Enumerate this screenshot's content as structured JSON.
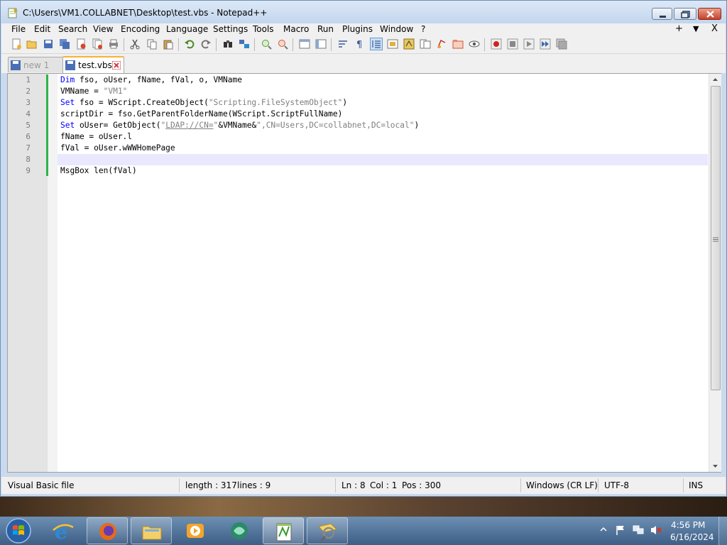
{
  "window": {
    "title": "C:\\Users\\VM1.COLLABNET\\Desktop\\test.vbs - Notepad++"
  },
  "menu": {
    "items": [
      "File",
      "Edit",
      "Search",
      "View",
      "Encoding",
      "Language",
      "Settings",
      "Tools",
      "Macro",
      "Run",
      "Plugins",
      "Window",
      "?"
    ],
    "right_controls": [
      "+",
      "▼",
      "X"
    ]
  },
  "tabs": [
    {
      "label": "new 1",
      "active": false
    },
    {
      "label": "test.vbs",
      "active": true
    }
  ],
  "editor": {
    "line_numbers": [
      "1",
      "2",
      "3",
      "4",
      "5",
      "6",
      "7",
      "8",
      "9"
    ],
    "current_line": 8,
    "lines": [
      [
        {
          "t": "Dim",
          "c": "kw"
        },
        {
          "t": " fso, oUser, fName, fVal, o, VMName",
          "c": ""
        }
      ],
      [
        {
          "t": "VMName = ",
          "c": ""
        },
        {
          "t": "\"VM1\"",
          "c": "str"
        }
      ],
      [
        {
          "t": "Set",
          "c": "kw"
        },
        {
          "t": " fso = WScript.CreateObject(",
          "c": ""
        },
        {
          "t": "\"Scripting.FileSystemObject\"",
          "c": "str"
        },
        {
          "t": ")",
          "c": ""
        }
      ],
      [
        {
          "t": "scriptDir = fso.GetParentFolderName(WScript.ScriptFullName)",
          "c": ""
        }
      ],
      [
        {
          "t": "Set",
          "c": "kw"
        },
        {
          "t": " oUser= GetObject(",
          "c": ""
        },
        {
          "t": "\"",
          "c": "str"
        },
        {
          "t": "LDAP://CN=",
          "c": "str ul"
        },
        {
          "t": "\"",
          "c": "str"
        },
        {
          "t": "&VMName&",
          "c": ""
        },
        {
          "t": "\",CN=Users,DC=collabnet,DC=local\"",
          "c": "str"
        },
        {
          "t": ")",
          "c": ""
        }
      ],
      [
        {
          "t": "fName = oUser.l",
          "c": ""
        }
      ],
      [
        {
          "t": "fVal = oUser.wWWHomePage",
          "c": ""
        }
      ],
      [
        {
          "t": "",
          "c": ""
        }
      ],
      [
        {
          "t": "MsgBox len(fVal)",
          "c": ""
        }
      ]
    ]
  },
  "status": {
    "file_type": "Visual Basic file",
    "length": "length : 317",
    "lines": "lines : 9",
    "ln": "Ln : 8",
    "col": "Col : 1",
    "pos": "Pos : 300",
    "eol": "Windows (CR LF)",
    "encoding": "UTF-8",
    "mode": "INS"
  },
  "taskbar": {
    "apps": [
      "internet-explorer",
      "firefox",
      "file-explorer",
      "media-player",
      "app-swirl",
      "notepad-plus-plus",
      "search-app"
    ],
    "clock_time": "4:56 PM",
    "clock_date": "6/16/2024"
  }
}
